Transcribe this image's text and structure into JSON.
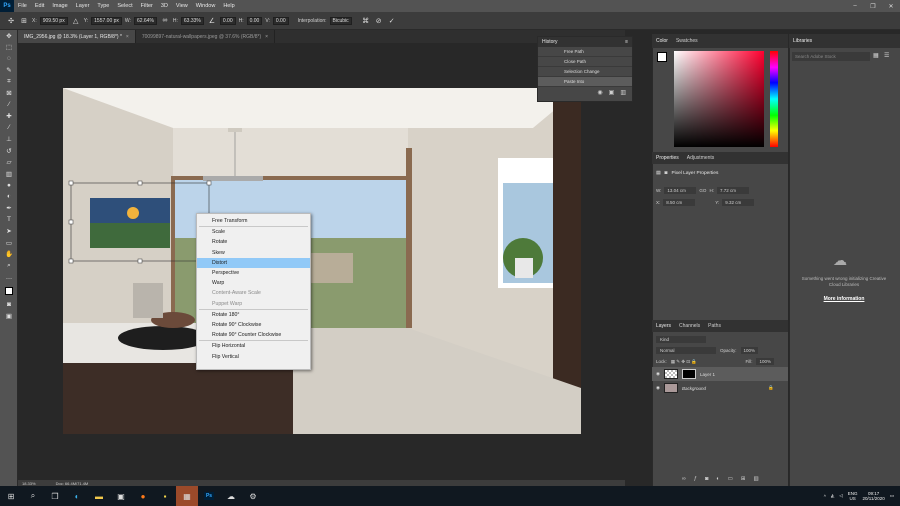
{
  "app_logo": "Ps",
  "menu": [
    "File",
    "Edit",
    "Image",
    "Layer",
    "Type",
    "Select",
    "Filter",
    "3D",
    "View",
    "Window",
    "Help"
  ],
  "options": {
    "x_label": "X:",
    "x_value": "909.50 px",
    "y_label": "Y:",
    "y_value": "1557.00 px",
    "w_label": "W:",
    "w_value": "62.64%",
    "h_label": "H:",
    "h_value": "63.33%",
    "angle_value": "0.00",
    "hskew_label": "H:",
    "hskew_value": "0.00",
    "vskew_label": "V:",
    "vskew_value": "0.00",
    "interp_label": "Interpolation:",
    "interp_value": "Bicubic"
  },
  "tabs": [
    {
      "label": "IMG_2956.jpg @ 18.3% (Layer 1, RGB/8*) *",
      "active": true
    },
    {
      "label": "70099897-natural-wallpapers.jpeg @ 37.6% (RGB/8*)",
      "active": false
    }
  ],
  "status": {
    "zoom": "18.33%",
    "doc": "Doc: 66.4M/71.4M"
  },
  "history": {
    "title": "History",
    "items": [
      {
        "label": "Free Path",
        "selected": false
      },
      {
        "label": "Close Path",
        "selected": false
      },
      {
        "label": "Selection Change",
        "selected": false
      },
      {
        "label": "Paste Into",
        "selected": true
      }
    ]
  },
  "color_panel": {
    "tab1": "Color",
    "tab2": "Swatches"
  },
  "properties": {
    "tab1": "Properties",
    "tab2": "Adjustments",
    "layer_kind": "Pixel Layer Properties",
    "w_label": "W:",
    "w": "13.04 cm",
    "go_label": "GO",
    "h_label": "H:",
    "h": "7.72 cm",
    "x_label": "X:",
    "x": "8.50 cm",
    "y_label": "Y:",
    "y": "9.32 cm"
  },
  "layers_panel": {
    "tabs": [
      "Layers",
      "Channels",
      "Paths"
    ],
    "kind_label": "Kind",
    "blend": "Normal",
    "opacity_label": "Opacity:",
    "opacity": "100%",
    "lock_label": "Lock:",
    "fill_label": "Fill:",
    "fill": "100%",
    "layers": [
      {
        "name": "Layer 1",
        "selected": true
      },
      {
        "name": "Background",
        "selected": false
      }
    ]
  },
  "libraries": {
    "title": "Libraries",
    "search_placeholder": "Search Adobe Stock",
    "message": "Something went wrong initializing Creative Cloud Libraries",
    "link": "More information"
  },
  "context_menu": [
    {
      "label": "Free Transform",
      "state": "normal"
    },
    {
      "sep": true
    },
    {
      "label": "Scale",
      "state": "normal"
    },
    {
      "label": "Rotate",
      "state": "normal"
    },
    {
      "label": "Skew",
      "state": "normal"
    },
    {
      "label": "Distort",
      "state": "highlight"
    },
    {
      "label": "Perspective",
      "state": "normal"
    },
    {
      "label": "Warp",
      "state": "normal"
    },
    {
      "label": "Content-Aware Scale",
      "state": "disabled"
    },
    {
      "label": "Puppet Warp",
      "state": "disabled"
    },
    {
      "sep": true
    },
    {
      "label": "Rotate 180°",
      "state": "normal"
    },
    {
      "label": "Rotate 90° Clockwise",
      "state": "normal"
    },
    {
      "label": "Rotate 90° Counter Clockwise",
      "state": "normal"
    },
    {
      "sep": true
    },
    {
      "label": "Flip Horizontal",
      "state": "normal"
    },
    {
      "label": "Flip Vertical",
      "state": "normal"
    }
  ],
  "taskbar": {
    "lang": "ENG",
    "region": "US",
    "time": "09:17",
    "date": "20/11/2020",
    "ps_label": "Ps"
  }
}
